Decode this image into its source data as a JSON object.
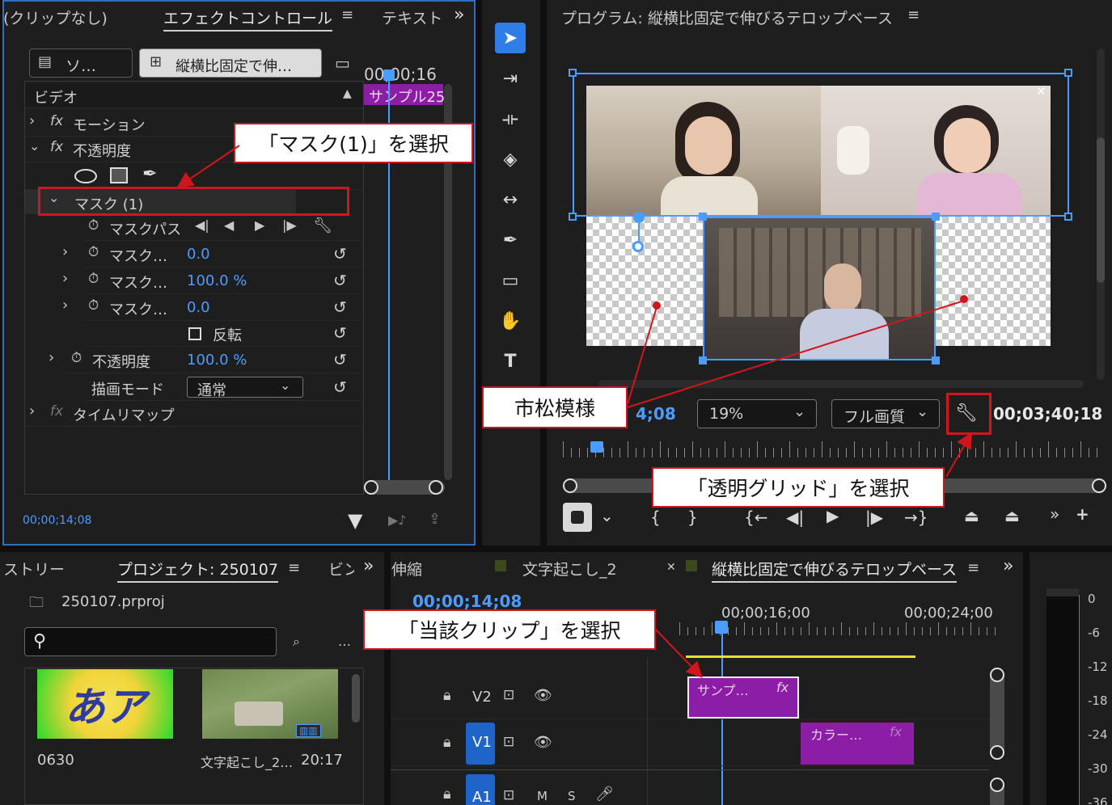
{
  "effect_controls": {
    "tab_source": "(クリップなし)",
    "tab_active": "エフェクトコントロール",
    "tab_text": "テキスト",
    "source_btn": "ソ…",
    "clip_btn": "縦横比固定で伸…",
    "timecode_top": "00;00;16",
    "clip_label": "サンプル25",
    "section_video": "ビデオ",
    "motion": "モーション",
    "opacity": "不透明度",
    "mask": "マスク (1)",
    "mask_path": "マスクパス",
    "mask_feather": "マスク…",
    "mask_feather_value": "0.0",
    "mask_opacity": "マスク…",
    "mask_opacity_value": "100.0 %",
    "mask_expansion": "マスク…",
    "mask_expansion_value": "0.0",
    "invert": "反転",
    "opacity_label": "不透明度",
    "opacity_value": "100.0 %",
    "blend_mode_label": "描画モード",
    "blend_mode_value": "通常",
    "time_remap": "タイムリマップ",
    "bottom_timecode": "00;00;14;08"
  },
  "program_monitor": {
    "title": "プログラム: 縦横比固定で伸びるテロップベース",
    "timecode_current": "4;08",
    "zoom": "19%",
    "quality": "フル画質",
    "timecode_duration": "00;03;40;18"
  },
  "project": {
    "tab_history": "ストリー",
    "tab_project": "プロジェクト: 250107",
    "tab_bin": "ビン",
    "filename": "250107.prproj",
    "search_placeholder": "",
    "item1_name": "0630",
    "item1_thumb_text": "あア",
    "item2_name": "文字起こし_2…",
    "item2_duration": "20:17"
  },
  "timeline": {
    "tab_prev": "伸縮",
    "tab_transcript": "文字起こし_2",
    "tab_active": "縦横比固定で伸びるテロップベース",
    "timecode": "00;00;14;08",
    "ruler_1": "00;00;16;00",
    "ruler_2": "00;00;24;00",
    "track_v2": "V2",
    "track_v1": "V1",
    "track_a1": "A1",
    "mute": "M",
    "solo": "S",
    "clip_v2": "サンプ…",
    "clip_v1": "カラー…",
    "fx": "fx"
  },
  "audio_meter": {
    "labels": [
      "0",
      "-6",
      "-12",
      "-18",
      "-24",
      "-30",
      "-36"
    ]
  },
  "annotations": {
    "mask_select": "「マスク(1)」を選択",
    "checker": "市松模様",
    "transparent_grid": "「透明グリッド」を選択",
    "clip_select": "「当該クリップ」を選択"
  },
  "colors": {
    "accent": "#4b9cff",
    "clip_purple": "#8b1ea5",
    "annotation_red": "#d0161c"
  }
}
